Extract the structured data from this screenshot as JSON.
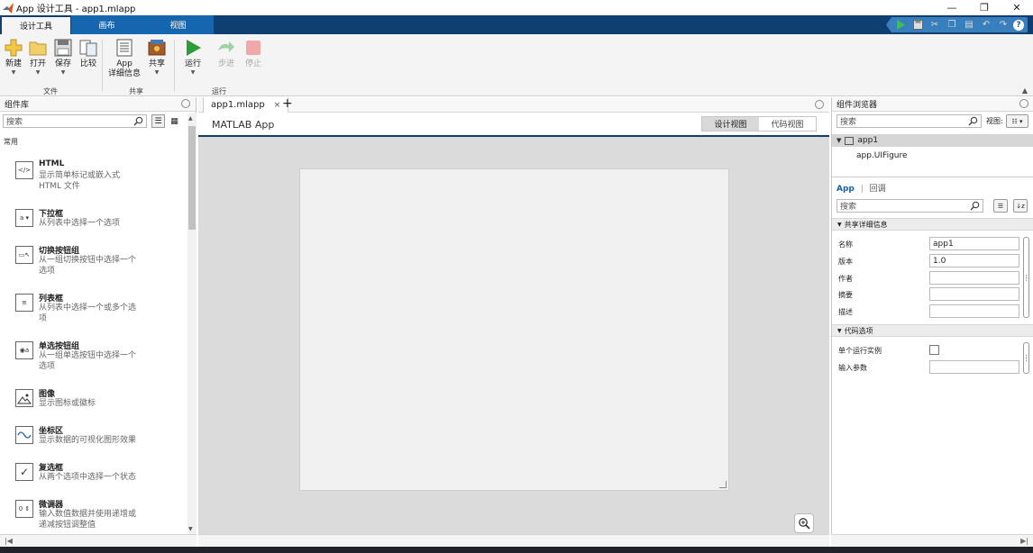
{
  "window": {
    "title": "App 设计工具 - app1.mlapp",
    "minimize": "—",
    "restore": "❐",
    "close": "✕"
  },
  "tabs": [
    "设计工具",
    "画布",
    "视图"
  ],
  "toolstrip": {
    "file": {
      "group": "文件",
      "new": "新建",
      "open": "打开",
      "save": "保存",
      "compare": "比较"
    },
    "share": {
      "group": "共享",
      "details_1": "App",
      "details_2": "详细信息",
      "share": "共享"
    },
    "run": {
      "group": "运行",
      "run": "运行",
      "step": "步进",
      "stop": "停止"
    }
  },
  "library": {
    "title": "组件库",
    "search_placeholder": "搜索",
    "section": "常用",
    "items": [
      {
        "name": "HTML",
        "desc": "显示简单标记或嵌入式 HTML 文件",
        "icon": "html-icon"
      },
      {
        "name": "下拉框",
        "desc": "从列表中选择一个选项",
        "icon": "dropdown-icon"
      },
      {
        "name": "切换按钮组",
        "desc": "从一组切换按钮中选择一个选项",
        "icon": "toggle-group-icon"
      },
      {
        "name": "列表框",
        "desc": "从列表中选择一个或多个选项",
        "icon": "listbox-icon"
      },
      {
        "name": "单选按钮组",
        "desc": "从一组单选按钮中选择一个选项",
        "icon": "radio-group-icon"
      },
      {
        "name": "图像",
        "desc": "显示图标或徽标",
        "icon": "image-icon"
      },
      {
        "name": "坐标区",
        "desc": "显示数据的可视化图形效果",
        "icon": "axes-icon"
      },
      {
        "name": "复选框",
        "desc": "从两个选项中选择一个状态",
        "icon": "checkbox-icon"
      },
      {
        "name": "微调器",
        "desc": "输入数值数据并使用递增或递减按钮调整值",
        "icon": "spinner-icon"
      }
    ]
  },
  "editor": {
    "tab": "app1.mlapp",
    "tab_close": "×",
    "add_tab": "+",
    "app_title": "MATLAB App",
    "design_view": "设计视图",
    "code_view": "代码视图"
  },
  "browser": {
    "title": "组件浏览器",
    "search_placeholder": "搜索",
    "view_label": "视图:",
    "root": "app1",
    "child": "app.UIFigure",
    "subtab_app": "App",
    "subtab_sep": "|",
    "subtab_callback": "回调",
    "search2_placeholder": "搜索",
    "section_details": "共享详细信息",
    "props": [
      {
        "label": "名称",
        "value": "app1"
      },
      {
        "label": "版本",
        "value": "1.0"
      },
      {
        "label": "作者",
        "value": ""
      },
      {
        "label": "摘要",
        "value": ""
      },
      {
        "label": "描述",
        "value": ""
      }
    ],
    "section_code": "代码选项",
    "single_instance": "单个运行实例",
    "input_args": "输入参数",
    "more": "⋮"
  },
  "colors": {
    "tab_strip": "#0e3f70",
    "run_green": "#2e9c3a",
    "link_blue": "#1a5ea8"
  }
}
